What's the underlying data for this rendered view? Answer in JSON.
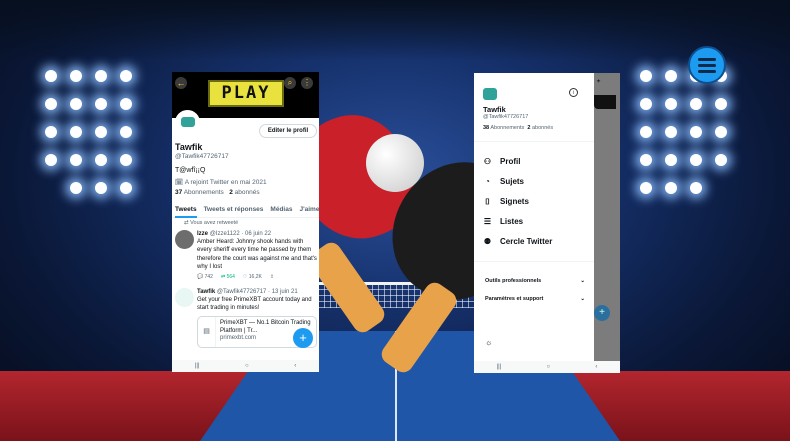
{
  "profile": {
    "header_banner": "PLAY",
    "edit_button": "Editer le profil",
    "name": "Tawfik",
    "handle": "@Tawfik47726717",
    "bio": "T@wfî¡¡Q",
    "joined": "A rejoint Twitter en mai 2021",
    "following_count": "37",
    "following_label": "Abonnements",
    "followers_count": "2",
    "followers_label": "abonnés",
    "tabs": [
      "Tweets",
      "Tweets et réponses",
      "Médias",
      "J'aime"
    ]
  },
  "tweets": [
    {
      "retweet_note": "Vous avez retweeté",
      "author": "Izze",
      "handle_date": "@Izze1122 · 06 juin 22",
      "text": "Amber Heard: Johnny shook hands with every sheriff every time he passed by them therefore the court was against me and that's why I lost",
      "actions": [
        "742",
        "564",
        "16,2K"
      ]
    },
    {
      "author": "Tawfik",
      "handle_date": "@Tawfik47726717 · 13 juin 21",
      "text": "Get your free PrimeXBT account today and start trading in minutes!",
      "card_title": "PrimeXBT — No.1 Bitcoin Trading Platform | Tr...",
      "card_url": "primexbt.com"
    }
  ],
  "drawer": {
    "name": "Tawfik",
    "handle": "@Tawfik47726717",
    "following_count": "38",
    "following_label": "Abonnements",
    "followers_count": "2",
    "followers_label": "abonnés",
    "items": [
      {
        "label": "Profil",
        "icon": "person-icon"
      },
      {
        "label": "Sujets",
        "icon": "topics-icon"
      },
      {
        "label": "Signets",
        "icon": "bookmark-icon"
      },
      {
        "label": "Listes",
        "icon": "list-icon"
      },
      {
        "label": "Cercle Twitter",
        "icon": "circle-icon"
      }
    ],
    "accordions": [
      "Outils professionnels",
      "Paramètres et support"
    ]
  },
  "colors": {
    "accent": "#1d9bf0",
    "retweet": "#00ba7c"
  }
}
